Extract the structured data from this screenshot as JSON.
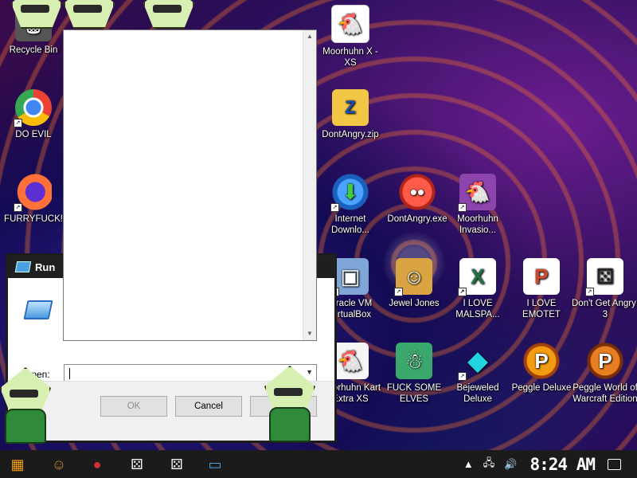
{
  "desktop": {
    "icons": [
      {
        "label": "Recycle Bin",
        "glyph": "🗑",
        "color": "#3a3a3a"
      },
      {
        "label": "DO EVIL",
        "glyph": "◉",
        "color": "#e94335"
      },
      {
        "label": "FURRYFUCK!",
        "glyph": "🦊",
        "color": "#ff7139"
      },
      {
        "label": "Moorhuhn X - XS",
        "glyph": "🐔",
        "color": "#c0392b"
      },
      {
        "label": "DontAngry.zip",
        "glyph": "Z",
        "color": "#f1c40f"
      },
      {
        "label": "Internet Downlo...",
        "glyph": "⬇",
        "color": "#2e86de"
      },
      {
        "label": "DontAngry.exe",
        "glyph": "●",
        "color": "#d63031"
      },
      {
        "label": "Moorhuhn Invasio...",
        "glyph": "🐔",
        "color": "#8e44ad"
      },
      {
        "label": "Oracle VM VirtualBox",
        "glyph": "▣",
        "color": "#4a7fbf"
      },
      {
        "label": "Jewel Jones",
        "glyph": "☺",
        "color": "#c68a2e"
      },
      {
        "label": "I LOVE MALSPA...",
        "glyph": "X",
        "color": "#1e7145"
      },
      {
        "label": "I LOVE EMOTET",
        "glyph": "P",
        "color": "#d24726"
      },
      {
        "label": "Don't Get Angry! 3",
        "glyph": "⚄",
        "color": "#f5f5f5"
      },
      {
        "label": "Moorhuhn Kart Extra XS",
        "glyph": "🐔",
        "color": "#2d2d2d"
      },
      {
        "label": "FUCK SOME ELVES",
        "glyph": "☃",
        "color": "#2e8b57"
      },
      {
        "label": "Bejeweled Deluxe",
        "glyph": "◆",
        "color": "#1abc9c"
      },
      {
        "label": "Peggle Deluxe",
        "glyph": "P",
        "color": "#e67e22"
      },
      {
        "label": "Peggle World of Warcraft Edition",
        "glyph": "P",
        "color": "#d35400"
      }
    ]
  },
  "run_dialog": {
    "title": "Run",
    "open_label": "Open:",
    "open_value": "",
    "ok_label": "OK",
    "cancel_label": "Cancel",
    "browse_label": ""
  },
  "taskbar": {
    "time": "8:24 AM",
    "pinned": [
      {
        "name": "start-button",
        "glyph": "▦",
        "color": "#f39c12"
      },
      {
        "name": "jewel-jones-taskbar",
        "glyph": "☺",
        "color": "#c68a2e"
      },
      {
        "name": "dontangry-taskbar",
        "glyph": "●",
        "color": "#d63031"
      },
      {
        "name": "dice-taskbar-1",
        "glyph": "⚄",
        "color": "#ecf0f1"
      },
      {
        "name": "dice-taskbar-2",
        "glyph": "⚄",
        "color": "#ecf0f1"
      },
      {
        "name": "run-taskbar",
        "glyph": "▭",
        "color": "#4aa0e0"
      }
    ]
  }
}
